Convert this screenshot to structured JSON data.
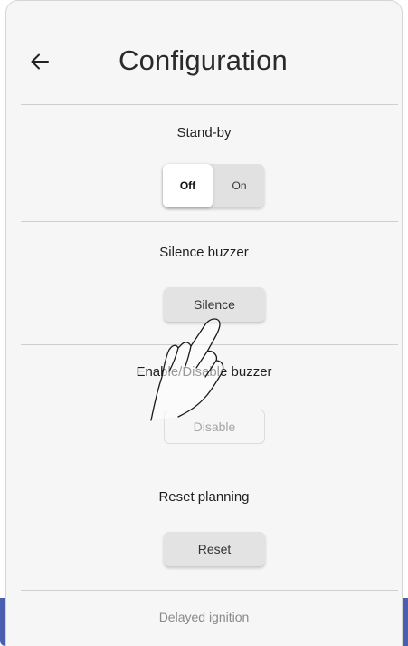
{
  "header": {
    "back_icon": "arrow-left-icon",
    "title": "Configuration"
  },
  "sections": {
    "standby": {
      "label": "Stand-by",
      "options": [
        "Off",
        "On"
      ],
      "selected": "Off"
    },
    "silence": {
      "label": "Silence buzzer",
      "button": "Silence"
    },
    "buzzer": {
      "label": "Enable/Disable buzzer",
      "button": "Disable",
      "button_state": "disabled"
    },
    "reset": {
      "label": "Reset planning",
      "button": "Reset"
    },
    "delayed": {
      "label": "Delayed ignition"
    }
  },
  "overlay": {
    "gesture_icon": "tap-hand-icon"
  },
  "colors": {
    "panel_bg": "#f6f6f6",
    "accent": "#4b5fb0",
    "divider": "#cfcfcf"
  }
}
